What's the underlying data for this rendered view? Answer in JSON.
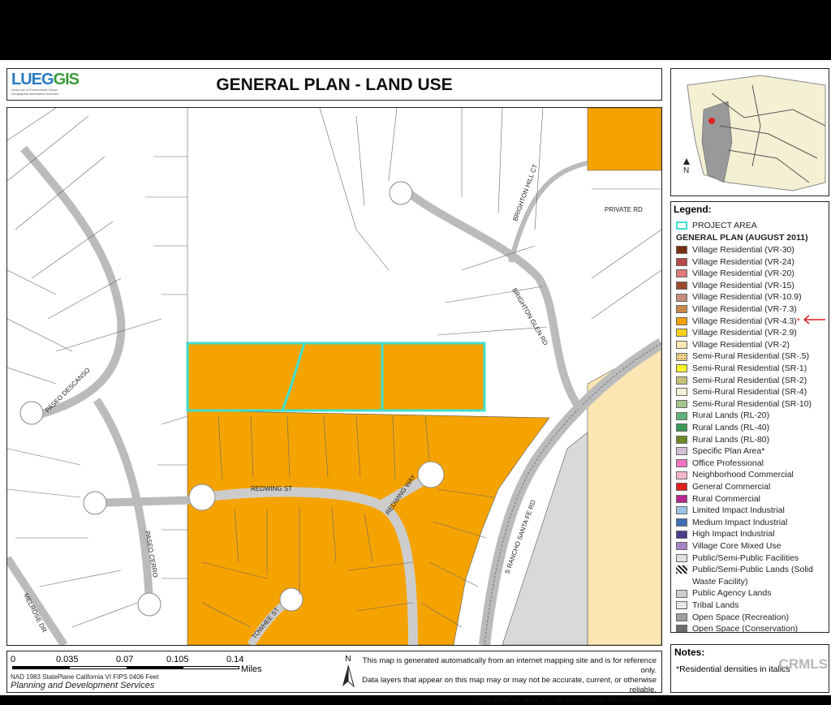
{
  "header": {
    "title": "GENERAL PLAN - LAND USE"
  },
  "logo": {
    "main_a": "LUEG",
    "main_b": "GIS",
    "sub1": "Land Use & Environment Group",
    "sub2": "Geographic Information Services"
  },
  "map": {
    "streets": {
      "private_rd": "PRIVATE RD",
      "brighton_hill": "BRIGHTON HILL CT",
      "brighton_glen": "BRIGHTON GLEN RD",
      "paseo_descanso": "PASEO DESCANSO",
      "redwing_st": "REDWING ST",
      "redwing_way": "REDWING WAY",
      "rancho_santa_fe": "S RANCHO SANTA FE RD",
      "paseo_cerro": "PASEO CERRO",
      "melrose": "MELROSE DR",
      "towhee": "TOWHEE ST"
    }
  },
  "inset": {
    "north": "N"
  },
  "legend": {
    "title": "Legend:",
    "project_area": "PROJECT AREA",
    "section": "GENERAL PLAN (AUGUST 2011)",
    "marker_note": "*",
    "items": [
      {
        "label": "Village Residential (VR-30)",
        "color": "#7a2e12"
      },
      {
        "label": "Village Residential (VR-24)",
        "color": "#b74a4a"
      },
      {
        "label": "Village Residential (VR-20)",
        "color": "#e07a7a"
      },
      {
        "label": "Village Residential (VR-15)",
        "color": "#9a4b2b"
      },
      {
        "label": "Village Residential (VR-10.9)",
        "color": "#c39080"
      },
      {
        "label": "Village Residential (VR-7.3)",
        "color": "#c8874a"
      },
      {
        "label": "Village Residential (VR-4.3)",
        "color": "#f5a300"
      },
      {
        "label": "Village Residential (VR-2.9)",
        "color": "#f7d21a"
      },
      {
        "label": "Village Residential (VR-2)",
        "color": "#fbe6b4"
      },
      {
        "label": "Semi-Rural Residential (SR-.5)",
        "color": "#f3dc9a"
      },
      {
        "label": "Semi-Rural Residential (SR-1)",
        "color": "#f7f42a"
      },
      {
        "label": "Semi-Rural Residential (SR-2)",
        "color": "#c8c07a"
      },
      {
        "label": "Semi-Rural Residential (SR-4)",
        "color": "#f4f0d4"
      },
      {
        "label": "Semi-Rural Residential (SR-10)",
        "color": "#a3c48e"
      },
      {
        "label": "Rural Lands (RL-20)",
        "color": "#5fb37b"
      },
      {
        "label": "Rural Lands (RL-40)",
        "color": "#3b9a58"
      },
      {
        "label": "Rural Lands (RL-80)",
        "color": "#6b8a2a"
      },
      {
        "label": "Specific Plan Area*",
        "color": "#d6c0d8"
      },
      {
        "label": "Office Professional",
        "color": "#f074c3"
      },
      {
        "label": "Neighborhood Commercial",
        "color": "#f5b6c9"
      },
      {
        "label": "General Commercial",
        "color": "#e01e1e"
      },
      {
        "label": "Rural Commercial",
        "color": "#b5278a"
      },
      {
        "label": "Limited Impact Industrial",
        "color": "#9cc3e6"
      },
      {
        "label": "Medium Impact Industrial",
        "color": "#3e6fb2"
      },
      {
        "label": "High Impact Industrial",
        "color": "#4b3b8c"
      },
      {
        "label": "Village Core Mixed Use",
        "color": "#a985c5"
      },
      {
        "label": "Public/Semi-Public Facilities",
        "color": "#e2e2e2"
      },
      {
        "label": "Public/Semi-Public Lands (Solid",
        "color": "#ffffff"
      },
      {
        "label": "Waste Facility)",
        "color": ""
      },
      {
        "label": "Public Agency Lands",
        "color": "#cfcfcf"
      },
      {
        "label": "Tribal Lands",
        "color": "#f2f2f2"
      },
      {
        "label": "Open Space (Recreation)",
        "color": "#9e9e9e"
      },
      {
        "label": "Open Space (Conservation)",
        "color": "#6e6e6e"
      }
    ]
  },
  "notes": {
    "title": "Notes:",
    "text": "*Residential densities in italics"
  },
  "scale": {
    "ticks": [
      "0",
      "0.035",
      "0.07",
      "0.105",
      "0.14"
    ],
    "unit": "Miles",
    "projection": "NAD 1983 StatePlane California VI FIPS 0406 Feet",
    "agency": "Planning and Development Services"
  },
  "disclaimer": {
    "north": "N",
    "line1": "This map is generated automatically from an internet mapping site and is for reference only.",
    "line2": "Data layers that appear on this map may or may not be accurate, current, or otherwise reliable.",
    "line3": "THIS MAP IS NOT TO BE USED FOR NAVIGATION."
  },
  "watermark": "CRMLS"
}
